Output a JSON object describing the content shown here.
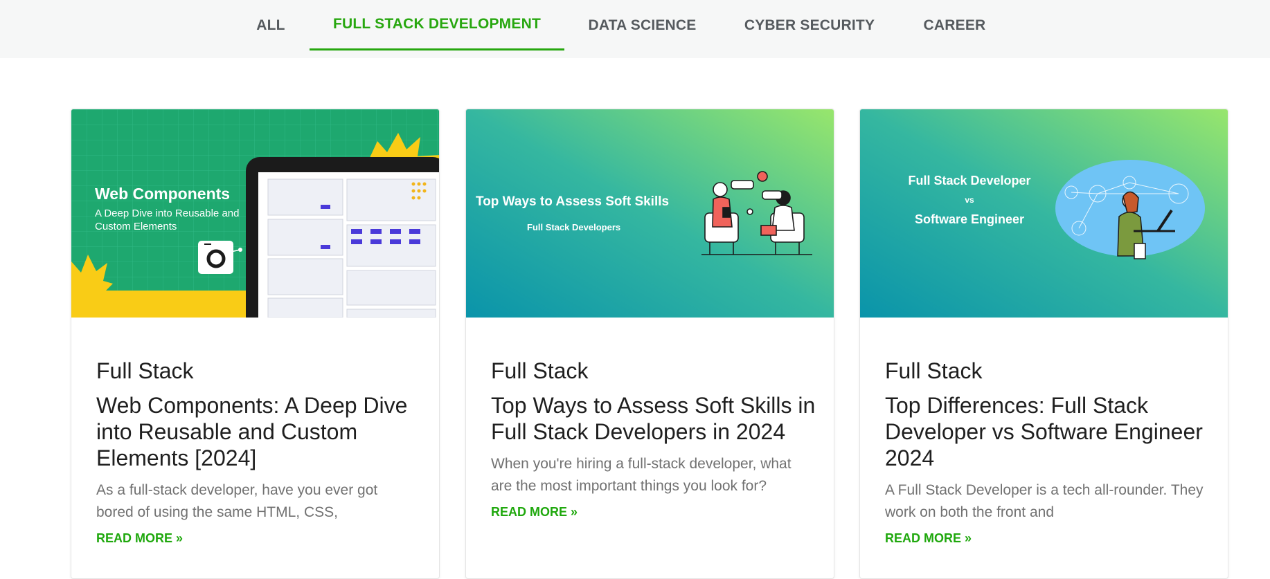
{
  "tabs": [
    {
      "label": "ALL",
      "active": false
    },
    {
      "label": "FULL STACK DEVELOPMENT",
      "active": true
    },
    {
      "label": "DATA SCIENCE",
      "active": false
    },
    {
      "label": "CYBER SECURITY",
      "active": false
    },
    {
      "label": "CAREER",
      "active": false
    }
  ],
  "colors": {
    "accent": "#27a70f",
    "tab_text": "#555a5e",
    "tabbar_bg": "#f6f7f7"
  },
  "cards": [
    {
      "thumb": {
        "heading": "Web Components",
        "sub1": "A Deep Dive into Reusable and",
        "sub2": "Custom Elements"
      },
      "category": "Full Stack",
      "title": "Web Components: A Deep Dive into Reusable and Custom Elements [2024]",
      "excerpt": "As a full-stack developer, have you ever got bored of using the same HTML, CSS,",
      "read_more": "READ MORE »"
    },
    {
      "thumb": {
        "heading": "Top Ways to Assess Soft Skills",
        "sub1": "Full Stack Developers"
      },
      "category": "Full Stack",
      "title": "Top Ways to Assess Soft Skills in Full Stack Developers in 2024",
      "excerpt": "When you're hiring a full-stack developer, what are the most important things you look for?",
      "read_more": "READ MORE »"
    },
    {
      "thumb": {
        "line1": "Full Stack Developer",
        "line2": "vs",
        "line3": "Software Engineer"
      },
      "category": "Full Stack",
      "title": "Top Differences: Full Stack Developer vs Software Engineer 2024",
      "excerpt": "A Full Stack Developer is a tech all-rounder. They work on both the front and",
      "read_more": "READ MORE »"
    }
  ]
}
